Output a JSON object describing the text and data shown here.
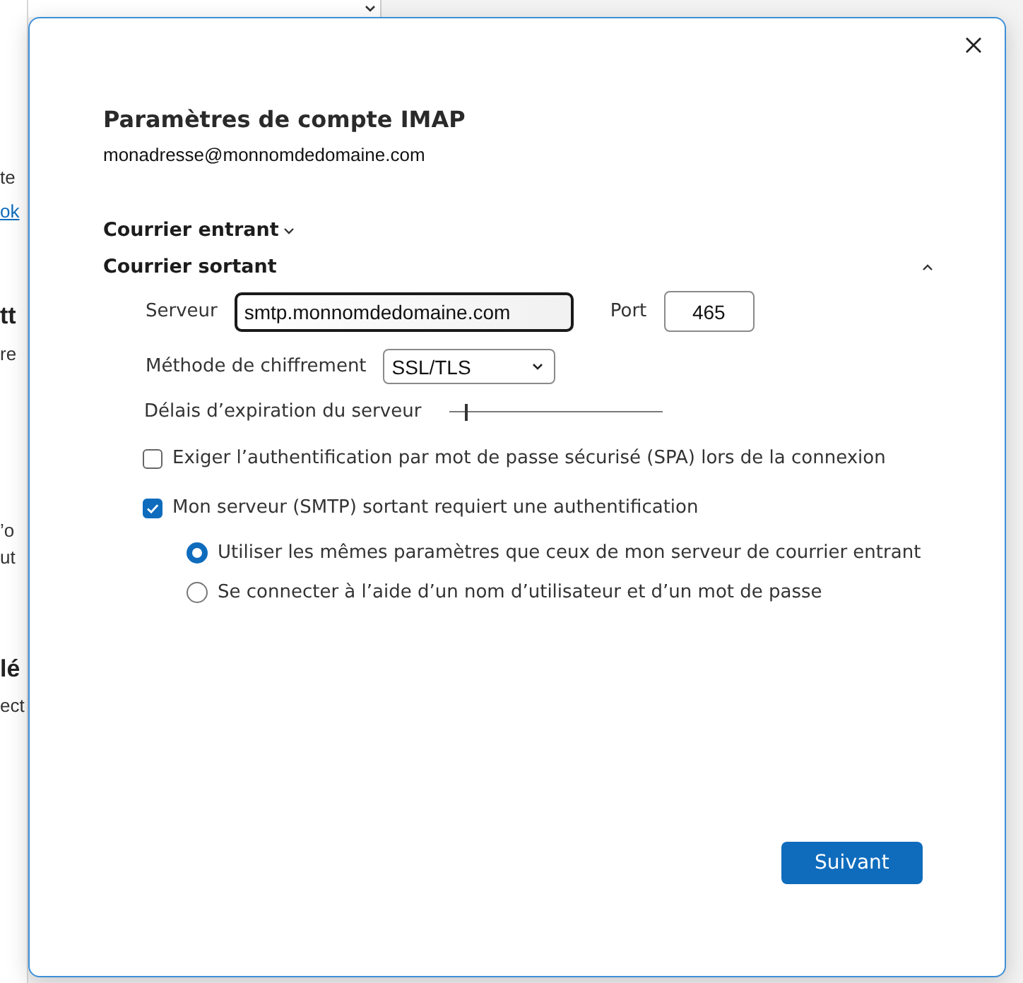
{
  "background_window": {
    "fragments": [
      {
        "text": "te",
        "kind": "text"
      },
      {
        "text": "ok",
        "kind": "link"
      },
      {
        "text": "tt",
        "kind": "heading"
      },
      {
        "text": "re",
        "kind": "text"
      },
      {
        "text": "’o",
        "kind": "text"
      },
      {
        "text": "ut",
        "kind": "text"
      },
      {
        "text": "lé",
        "kind": "heading"
      },
      {
        "text": "ect",
        "kind": "text"
      }
    ]
  },
  "dialog": {
    "title": "Paramètres de compte IMAP",
    "account": "monadresse@monnomdedomaine.com",
    "sections": [
      {
        "label": "Courrier entrant",
        "expanded": false
      },
      {
        "label": "Courrier sortant",
        "expanded": true
      }
    ],
    "server": {
      "label": "Serveur",
      "value": "smtp.monnomdedomaine.com"
    },
    "port": {
      "label": "Port",
      "value": "465"
    },
    "encryption": {
      "label": "Méthode de chiffrement",
      "value": "SSL/TLS"
    },
    "timeout": {
      "label": "Délais d’expiration du serveur",
      "level": 0.08
    },
    "options": [
      {
        "kind": "checkbox",
        "label": "Exiger l’authentification par mot de passe sécurisé (SPA) lors de la connexion",
        "checked": false
      },
      {
        "kind": "checkbox",
        "label": "Mon serveur (SMTP) sortant requiert une authentification",
        "checked": true
      },
      {
        "kind": "radio",
        "label": "Utiliser les mêmes paramètres que ceux de mon serveur de courrier entrant",
        "selected": true
      },
      {
        "kind": "radio",
        "label": "Se connecter à l’aide d’un nom d’utilisateur et d’un mot de passe",
        "selected": false
      }
    ],
    "next_button": "Suivant"
  }
}
